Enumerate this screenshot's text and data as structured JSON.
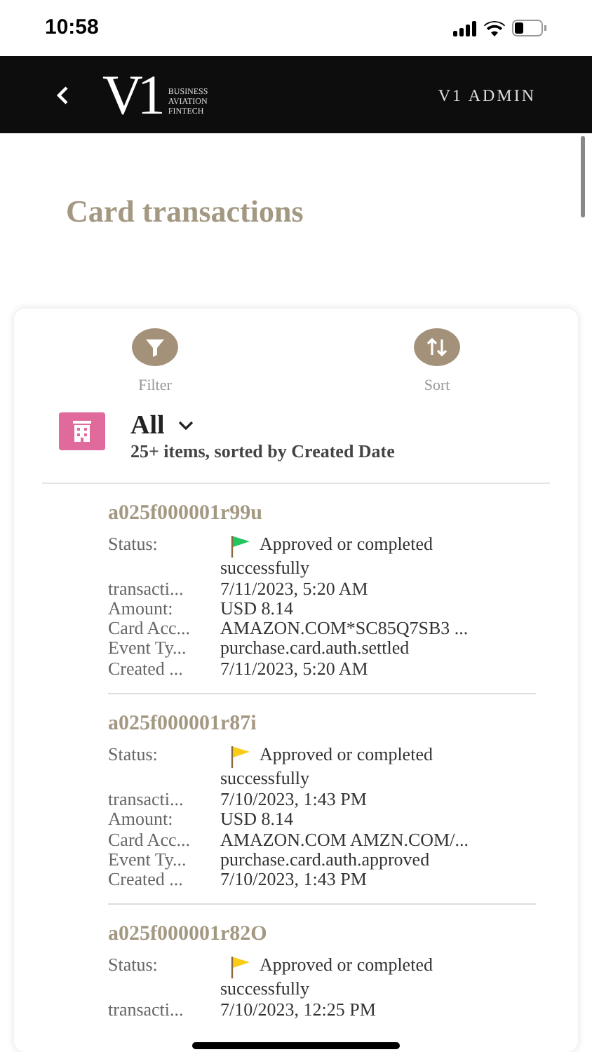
{
  "status_bar": {
    "time": "10:58"
  },
  "header": {
    "logo_letters": "V1",
    "logo_lines": [
      "BUSINESS",
      "AVIATION",
      "FINTECH"
    ],
    "title": "V1 ADMIN"
  },
  "page_title": "Card transactions",
  "actions": [
    {
      "kind": "filter",
      "label": "Filter"
    },
    {
      "kind": "sort",
      "label": "Sort"
    }
  ],
  "list_view": {
    "name": "All",
    "summary": "25+ items, sorted by Created Date"
  },
  "records": [
    {
      "id": "a025f000001r99u",
      "color": "#22c55e",
      "status_label": "Status:",
      "status_value": "Approved or completed successfully",
      "fields": [
        {
          "label": "transacti...",
          "value": "7/11/2023, 5:20 AM"
        },
        {
          "label": "Amount:",
          "value": "USD 8.14"
        },
        {
          "label": "Card Acc...",
          "value": "AMAZON.COM*SC85Q7SB3 ..."
        },
        {
          "label": "Event Ty...",
          "value": "purchase.card.auth.settled"
        },
        {
          "label": "Created ...",
          "value": "7/11/2023, 5:20 AM"
        }
      ]
    },
    {
      "id": "a025f000001r87i",
      "color": "#facc15",
      "status_label": "Status:",
      "status_value": "Approved or completed successfully",
      "fields": [
        {
          "label": "transacti...",
          "value": "7/10/2023, 1:43 PM"
        },
        {
          "label": "Amount:",
          "value": "USD 8.14"
        },
        {
          "label": "Card Acc...",
          "value": "AMAZON.COM AMZN.COM/..."
        },
        {
          "label": "Event Ty...",
          "value": "purchase.card.auth.approved"
        },
        {
          "label": "Created ...",
          "value": "7/10/2023, 1:43 PM"
        }
      ]
    },
    {
      "id": "a025f000001r82O",
      "color": "#facc15",
      "status_label": "Status:",
      "status_value": "Approved or completed successfully",
      "fields": [
        {
          "label": "transacti...",
          "value": "7/10/2023, 12:25 PM"
        }
      ]
    }
  ]
}
